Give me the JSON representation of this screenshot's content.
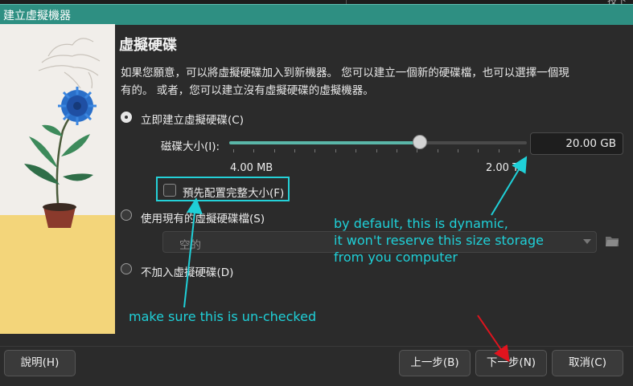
{
  "window": {
    "title": "建立虛擬機器",
    "corner_text": "技下"
  },
  "page": {
    "heading": "虛擬硬碟",
    "description": "如果您願意，可以將虛擬硬碟加入到新機器。 您可以建立一個新的硬碟檔，也可以選擇一個現有的。 或者，您可以建立沒有虛擬硬碟的虛擬機器。"
  },
  "options": {
    "create_new": {
      "label": "立即建立虛擬硬碟(C)",
      "selected": true
    },
    "use_existing": {
      "label": "使用現有的虛擬硬碟檔(S)",
      "selected": false,
      "combo_value": "空的"
    },
    "none": {
      "label": "不加入虛擬硬碟(D)",
      "selected": false
    }
  },
  "disk": {
    "size_label": "磁碟大小(I):",
    "size_value": "20.00 GB",
    "slider_fraction": 0.64,
    "min_label": "4.00 MB",
    "max_label": "2.00 TB",
    "preallocate_label": "預先配置完整大小(F)",
    "preallocate_checked": false
  },
  "annotations": {
    "dynamic_note": [
      "by default, this is dynamic,",
      "it won't reserve this size storage",
      "from you computer"
    ],
    "uncheck_note": "make sure this is un-checked",
    "highlight_color": "#24d1d8",
    "arrow_color": "#e0141e"
  },
  "buttons": {
    "help": "說明(H)",
    "back": "上一步(B)",
    "next": "下一步(N)",
    "cancel": "取消(C)"
  },
  "colors": {
    "accent": "#2e8f82",
    "slider": "#5ab6a8",
    "background": "#2b2b2b"
  }
}
